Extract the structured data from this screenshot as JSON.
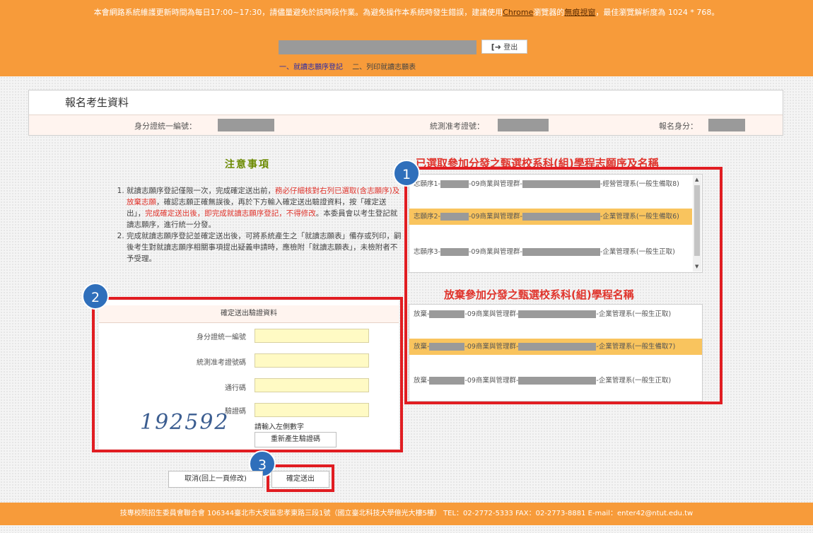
{
  "banner": {
    "notice_line1": "本會網路系統維護更新時間為每日17:00~17:30，請儘量避免於該時段作業。為避免操作本系統時發生錯誤，建議使用",
    "browser_link": "Chrome",
    "notice_mid": "瀏覽器的",
    "mode_link": "無痕視窗",
    "notice_line2": "，最佳瀏覽解析度為 1024 * 768。",
    "logout_label": "登出",
    "step1": "一、就讀志願序登記",
    "step2": "二、列印就讀志願表"
  },
  "applicant": {
    "title": "報名考生資料",
    "id_label": "身分證統一編號：",
    "exam_label": "統測准考證號：",
    "status_label": "報名身分："
  },
  "notes": {
    "title": "注意事項",
    "item1_a": "就讀志願序登記僅限一次，完成確定送出前，",
    "item1_red1": "務必仔細核對右列已選取(含志願序)及放棄志願",
    "item1_b": "，確認志願正確無誤後，再於下方輸入確定送出驗證資料，按「確定送出」，",
    "item1_red2": "完成確定送出後，即完成就讀志願序登記，不得修改",
    "item1_c": "。本委員會以考生登記就讀志願序，進行統一分發。",
    "item2": "完成就讀志願序登記並確定送出後，可將系統產生之「就讀志願表」備存或列印，嗣後考生對就讀志願序相關事項提出疑義申請時，應檢附「就讀志願表」，未檢附者不予受理。"
  },
  "verify": {
    "header": "確定送出驗證資料",
    "id_label": "身分證統一編號",
    "exam_label": "統測准考證號碼",
    "pass_label": "通行碼",
    "code_label": "驗證碼",
    "captcha": "192592",
    "hint": "請輸入左側數字",
    "regen_label": "重新產生驗證碼"
  },
  "choices": {
    "title": "已選取參加分發之甄選校系科(組)學程志願序及名稱",
    "items": [
      {
        "prefix": "志願序1-",
        "group": "-09商業與管理群-",
        "suffix": "-經營管理系(一般生備取8)"
      },
      {
        "prefix": "志願序2-",
        "group": "-09商業與管理群-",
        "suffix": "-企業管理系(一般生備取6)"
      },
      {
        "prefix": "志願序3-",
        "group": "-09商業與管理群-",
        "suffix": "-企業管理系(一般生正取)"
      }
    ]
  },
  "abandon": {
    "title": "放棄參加分發之甄選校系科(組)學程名稱",
    "items": [
      {
        "prefix": "放棄-",
        "group": "-09商業與管理群-",
        "suffix": "-企業管理系(一般生正取)"
      },
      {
        "prefix": "放棄-",
        "group": "-09商業與管理群-",
        "suffix": "-企業管理系(一般生備取7)"
      },
      {
        "prefix": "放棄-",
        "group": "-09商業與管理群-",
        "suffix": "-企業管理系(一般生正取)"
      }
    ]
  },
  "buttons": {
    "cancel": "取消(回上一頁修改)",
    "submit": "確定送出"
  },
  "badges": [
    "1",
    "2",
    "3"
  ],
  "footer": "技專校院招生委員會聯合會 106344臺北市大安區忠孝東路三段1號（國立臺北科技大學億光大樓5樓） TEL：02-2772-5333 FAX：02-2773-8881 E-mail：enter42@ntut.edu.tw",
  "colors": {
    "banner": "#f79b3a",
    "highlight_red": "#e11d22",
    "badge_blue": "#2f6fbb",
    "selected_row": "#f9c45e"
  }
}
